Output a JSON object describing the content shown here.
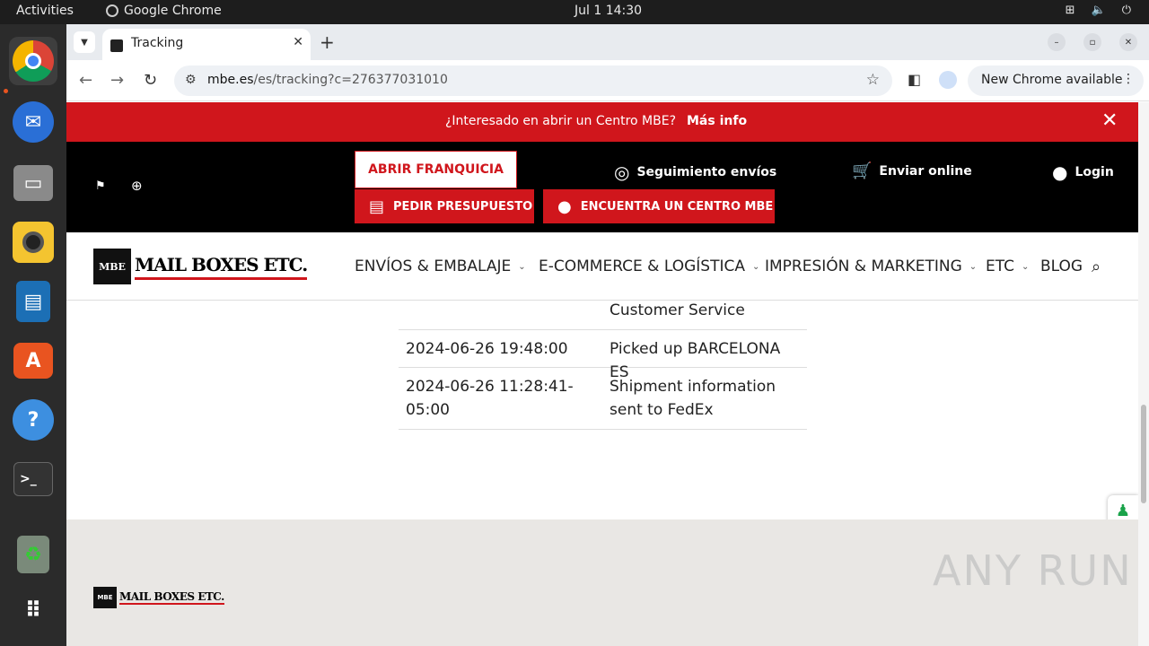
{
  "system": {
    "activities": "Activities",
    "app_name": "Google Chrome",
    "clock": "Jul 1  14:30"
  },
  "browser": {
    "tab_title": "Tracking",
    "url_domain": "mbe.es",
    "url_path": "/es/tracking?c=276377031010",
    "new_chrome": "New Chrome available"
  },
  "promo": {
    "question": "¿Interesado en abrir un Centro MBE?",
    "more": "Más info"
  },
  "header": {
    "franquicia": "ABRIR FRANQUICIA",
    "presupuesto": "PEDIR PRESUPUESTO",
    "centro": "ENCUENTRA UN CENTRO MBE",
    "seguimiento": "Seguimiento envíos",
    "enviar": "Enviar online",
    "login": "Login"
  },
  "logo": {
    "badge": "MBE",
    "text": "MAIL BOXES ETC."
  },
  "nav": {
    "items": [
      "ENVÍOS & EMBALAJE",
      "E-COMMERCE & LOGÍSTICA",
      "IMPRESIÓN & MARKETING",
      "ETC",
      "BLOG"
    ]
  },
  "tracking": {
    "rows": [
      {
        "date": "",
        "event": "Customer Service"
      },
      {
        "date": "2024-06-26 19:48:00",
        "event": "Picked up BARCELONA ES"
      },
      {
        "date": "2024-06-26 11:28:41-05:00",
        "event": "Shipment information sent to FedEx"
      }
    ]
  },
  "footer": {
    "watermark": "ANY RUN"
  },
  "colors": {
    "brand_red": "#d0161c",
    "black_bar": "#000000",
    "footer_bg": "#e9e7e4"
  }
}
